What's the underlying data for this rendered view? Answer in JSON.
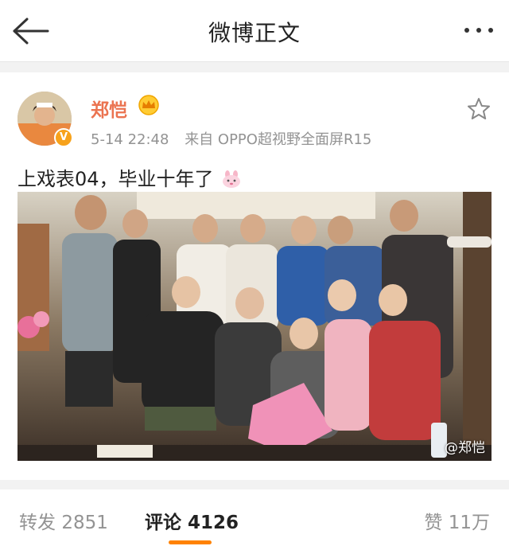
{
  "nav": {
    "title": "微博正文",
    "back_icon": "back-arrow-icon",
    "more_icon": "more-dots-icon"
  },
  "post": {
    "author": "郑恺",
    "time": "5-14 22:48",
    "source": "来自 OPPO超视野全面屏R15",
    "text": "上戏表04，毕业十年了",
    "photo_watermark": "@郑恺",
    "badge_icon": "verified-badge-icon",
    "crown_icon": "crown-icon",
    "favorite_icon": "star-outline-icon",
    "emoji_icon": "bunny-emoji-icon"
  },
  "tabs": {
    "repost_label": "转发",
    "repost_count": "2851",
    "comment_label": "评论",
    "comment_count": "4126",
    "like_label": "赞",
    "like_count": "11万"
  },
  "colors": {
    "accent": "#ff8200",
    "author_name": "#eb7350",
    "meta_text": "#939393",
    "background": "#f2f2f2"
  }
}
